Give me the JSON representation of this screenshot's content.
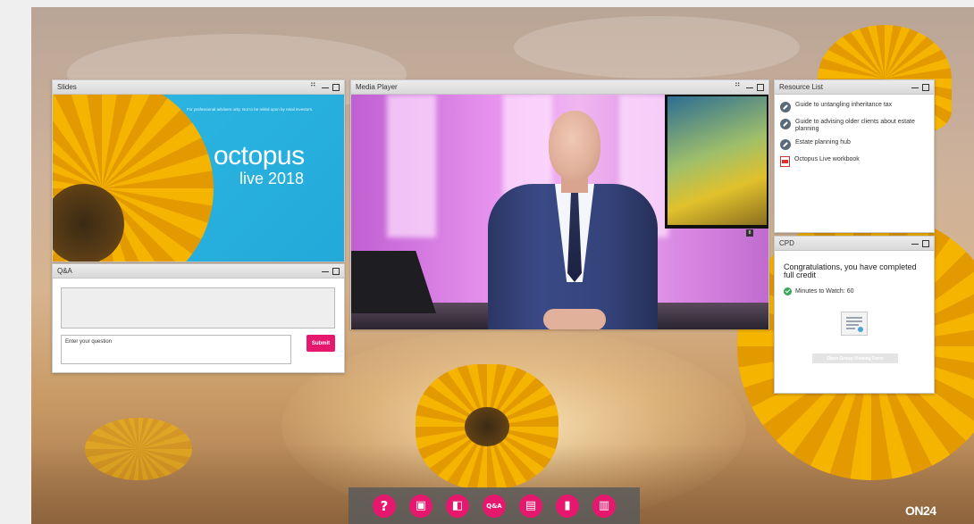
{
  "panels": {
    "slides": {
      "title": "Slides",
      "disclaimer": "For professional advisers only. Not to be relied upon by retail investors.",
      "brand_name": "octopus",
      "brand_event": "live 2018"
    },
    "qa": {
      "title": "Q&A",
      "input_placeholder": "Enter your question",
      "submit_label": "Submit"
    },
    "media": {
      "title": "Media Player",
      "overlay_badge": "8"
    },
    "resources": {
      "title": "Resource List",
      "items": [
        {
          "label": "Guide to untangling inheritance tax",
          "icon": "link-icon"
        },
        {
          "label": "Guide to advising older clients about estate planning",
          "icon": "link-icon"
        },
        {
          "label": "Estate planning hub",
          "icon": "link-icon"
        },
        {
          "label": "Octopus Live workbook",
          "icon": "pdf-icon"
        }
      ]
    },
    "cpd": {
      "title": "CPD",
      "heading": "Congratulations, you have completed full credit",
      "minutes": "Minutes to Watch: 60",
      "button_label": "Open Group Viewing Form"
    }
  },
  "dock": {
    "items": [
      {
        "name": "help",
        "glyph": "?"
      },
      {
        "name": "slides",
        "glyph": "▣"
      },
      {
        "name": "media",
        "glyph": "◧"
      },
      {
        "name": "qa",
        "glyph": "Q&A"
      },
      {
        "name": "certificate",
        "glyph": "▤"
      },
      {
        "name": "resources",
        "glyph": "▮"
      },
      {
        "name": "survey",
        "glyph": "▥"
      }
    ]
  },
  "branding": {
    "logo": "ON24"
  },
  "colors": {
    "accent": "#e6186e",
    "slide_bg": "#23a9d9"
  }
}
